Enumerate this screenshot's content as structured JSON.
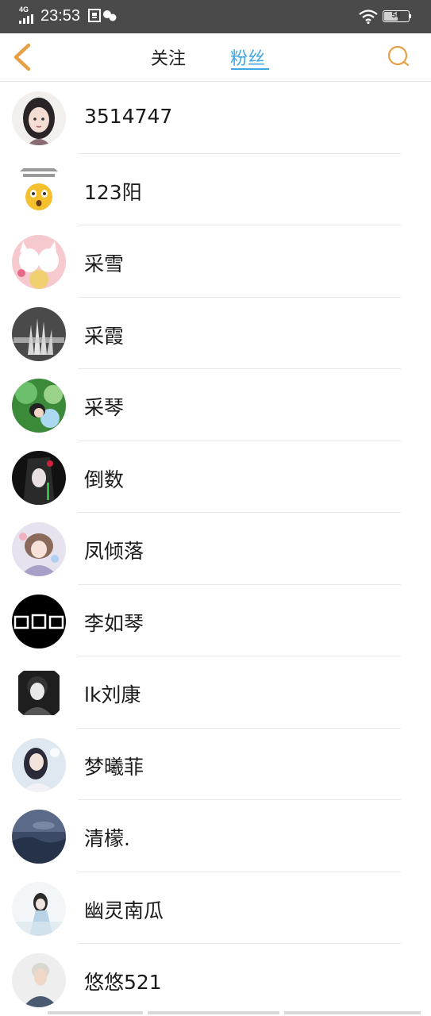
{
  "status_bar": {
    "network": "4G",
    "time": "23:53",
    "battery": "58",
    "battery_level": 0.58
  },
  "nav": {
    "tab_following": "关注",
    "tab_fans": "粉丝",
    "active_tab": "粉丝",
    "back_icon": "chevron-left-icon",
    "search_icon": "search-icon",
    "accent_color": "#3fa6e6",
    "icon_color": "#e8a046"
  },
  "fans": [
    {
      "name": "3514747"
    },
    {
      "name": "123阳"
    },
    {
      "name": "采雪"
    },
    {
      "name": "采霞"
    },
    {
      "name": "采琴"
    },
    {
      "name": "倒数"
    },
    {
      "name": "凤倾落"
    },
    {
      "name": "李如琴"
    },
    {
      "name": "lk刘康"
    },
    {
      "name": "梦曦菲"
    },
    {
      "name": "清檬."
    },
    {
      "name": "幽灵南瓜"
    },
    {
      "name": "悠悠521"
    }
  ]
}
